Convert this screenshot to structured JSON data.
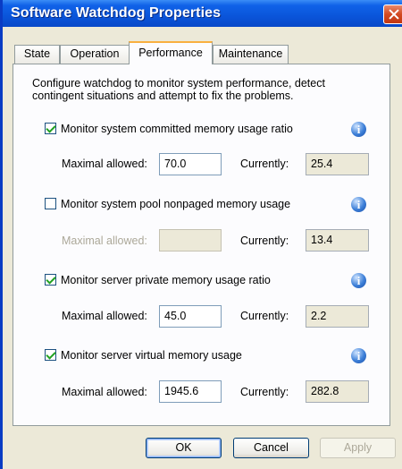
{
  "window": {
    "title": "Software Watchdog Properties"
  },
  "tabs": [
    {
      "label": "State",
      "active": false
    },
    {
      "label": "Operation",
      "active": false
    },
    {
      "label": "Performance",
      "active": true
    },
    {
      "label": "Maintenance",
      "active": false
    }
  ],
  "description": "Configure watchdog to monitor system performance, detect contingent situations and attempt to fix the problems.",
  "monitors": [
    {
      "label": "Monitor system committed memory usage ratio",
      "checked": true,
      "max_label": "Maximal allowed:",
      "max_value": "70.0",
      "current_label": "Currently:",
      "current_value": "25.4"
    },
    {
      "label": "Monitor system pool nonpaged memory usage",
      "checked": false,
      "max_label": "Maximal allowed:",
      "max_value": "",
      "current_label": "Currently:",
      "current_value": "13.4"
    },
    {
      "label": "Monitor server private memory usage ratio",
      "checked": true,
      "max_label": "Maximal allowed:",
      "max_value": "45.0",
      "current_label": "Currently:",
      "current_value": "2.2"
    },
    {
      "label": "Monitor server virtual memory usage",
      "checked": true,
      "max_label": "Maximal allowed:",
      "max_value": "1945.6",
      "current_label": "Currently:",
      "current_value": "282.8"
    }
  ],
  "info_icon": "i",
  "buttons": {
    "ok": "OK",
    "cancel": "Cancel",
    "apply": "Apply"
  },
  "colors": {
    "titlebar": "#0a55da",
    "dialog_bg": "#ece9d8",
    "check": "#21a121"
  }
}
